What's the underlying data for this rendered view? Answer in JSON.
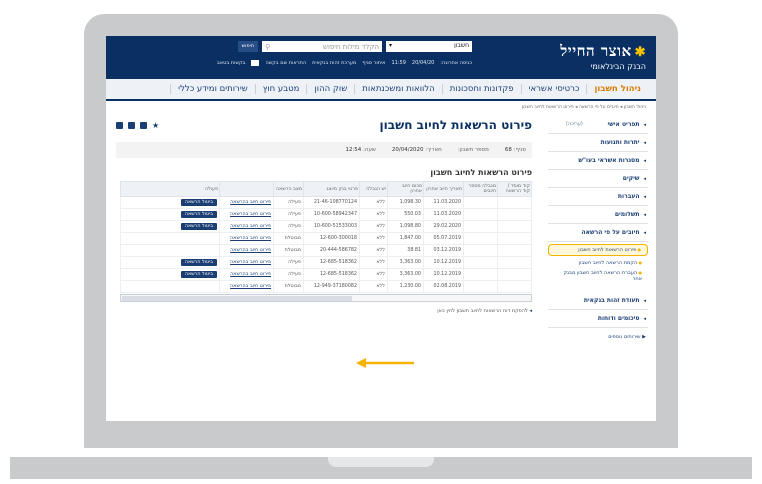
{
  "header": {
    "logo_main": "אוצר החייל",
    "logo_sub": "הבנק הבינלאומי",
    "account_selector": "חשבון",
    "search_placeholder": "הקלד מילות חיפוש",
    "search_button": "חיפוש",
    "last_login_label": "כניסה אחרונה:",
    "last_login_date": "20/04/20",
    "last_login_time": "11:59",
    "links": [
      "איתור סניף",
      "מערכת זהות בנקאית",
      "התראות שם בקשה",
      "בקשות בטאב"
    ]
  },
  "nav": {
    "items": [
      "ניהול חשבון",
      "כרטיסי אשראי",
      "פקדונות וחסכונות",
      "הלוואות ומשכנתאות",
      "שוק ההון",
      "מטבע חוץ",
      "שירותים ומידע כללי"
    ]
  },
  "breadcrumb": "ניהול חשבון ◂ חיובים על פי הרשאה ◂ פירוט הרשאות לחיוב חשבון",
  "page": {
    "title": "פירוט הרשאות לחיוב חשבון",
    "branch_label": "סניף:",
    "branch_value": "68",
    "account_label": "מספר חשבון:",
    "date_label": "תאריך:",
    "date_value": "20/04/2020",
    "time_label": "שעה:",
    "time_value": "12:54",
    "section_title": "פירוט הרשאות לחיוב חשבון"
  },
  "table": {
    "headers": [
      "קוד מוסד / קוד הרשאה",
      "מגבלה מספר חיובים",
      "תאריך חיוב אחרון",
      "סכום חיוב אחרון",
      "יש הגבלה",
      "פרטי בנק מיוצג",
      "מצב הרשאה",
      "",
      "פעולה"
    ],
    "rows": [
      {
        "date": "11.03.2020",
        "amount": "1,098.30",
        "limit": "ללא",
        "ref": "21-46-108770124",
        "status": "פעילה",
        "detail": "פירוט חיוב בהרשאה",
        "action": "ביטול הרשאה"
      },
      {
        "date": "11.03.2020",
        "amount": "550.03",
        "limit": "ללא",
        "ref": "10-600-58942347",
        "status": "פעילה",
        "detail": "פירוט חיוב בהרשאה",
        "action": "ביטול הרשאה"
      },
      {
        "date": "29.02.2020",
        "amount": "1,098.80",
        "limit": "ללא",
        "ref": "10-600-51533003",
        "status": "פעילה",
        "detail": "פירוט חיוב בהרשאה",
        "action": "ביטול הרשאה"
      },
      {
        "date": "05.07.2019",
        "amount": "1,847.00",
        "limit": "ללא",
        "ref": "12-600-300018",
        "status": "מבוטלת",
        "detail": "פירוט חיוב בהרשאה",
        "action": ""
      },
      {
        "date": "03.12.2019",
        "amount": "38.81",
        "limit": "ללא",
        "ref": "20-444-586782",
        "status": "מבוטלת",
        "detail": "פירוט חיוב בהרשאה",
        "action": ""
      },
      {
        "date": "10.12.2019",
        "amount": "3,363.00",
        "limit": "ללא",
        "ref": "12-685-518362",
        "status": "פעילה",
        "detail": "פירוט חיוב בהרשאה",
        "action": "ביטול הרשאה"
      },
      {
        "date": "10.12.2019",
        "amount": "3,363.00",
        "limit": "ללא",
        "ref": "12-685-518362",
        "status": "פעילה",
        "detail": "פירוט חיוב בהרשאה",
        "action": "ביטול הרשאה"
      },
      {
        "date": "02.08.2019",
        "amount": "1,230.00",
        "limit": "ללא",
        "ref": "12-949-37180082",
        "status": "מבוטלת",
        "detail": "פירוט חיוב בהרשאה",
        "action": ""
      }
    ]
  },
  "footer_link": "להפקת דוח הרשאות לחיוב חשבון לחץ כאן",
  "sidebar": {
    "items": [
      {
        "label": "תפריט אישי",
        "tag": "(עריכה)"
      },
      {
        "label": "יתרות ותנועות"
      },
      {
        "label": "מסגרות אשראי בעו\"ש"
      },
      {
        "label": "שיקים"
      },
      {
        "label": "העברות"
      },
      {
        "label": "תשלומים"
      },
      {
        "label": "חיובים על פי הרשאה"
      }
    ],
    "sub_links": [
      "פירוט הרשאות לחיוב חשבון",
      "הקמת הרשאה לחיוב חשבון",
      "העברת הרשאה לחיוב חשבון מבנק אחר"
    ],
    "bottom_items": [
      {
        "label": "תעודת זהות בנקאית"
      },
      {
        "label": "סיכומים ודוחות"
      }
    ],
    "more": "שירותים נוספים"
  },
  "colors": {
    "brand_navy": "#0a2f63",
    "accent_yellow": "#f3b400",
    "active_tab": "#d97a00"
  }
}
